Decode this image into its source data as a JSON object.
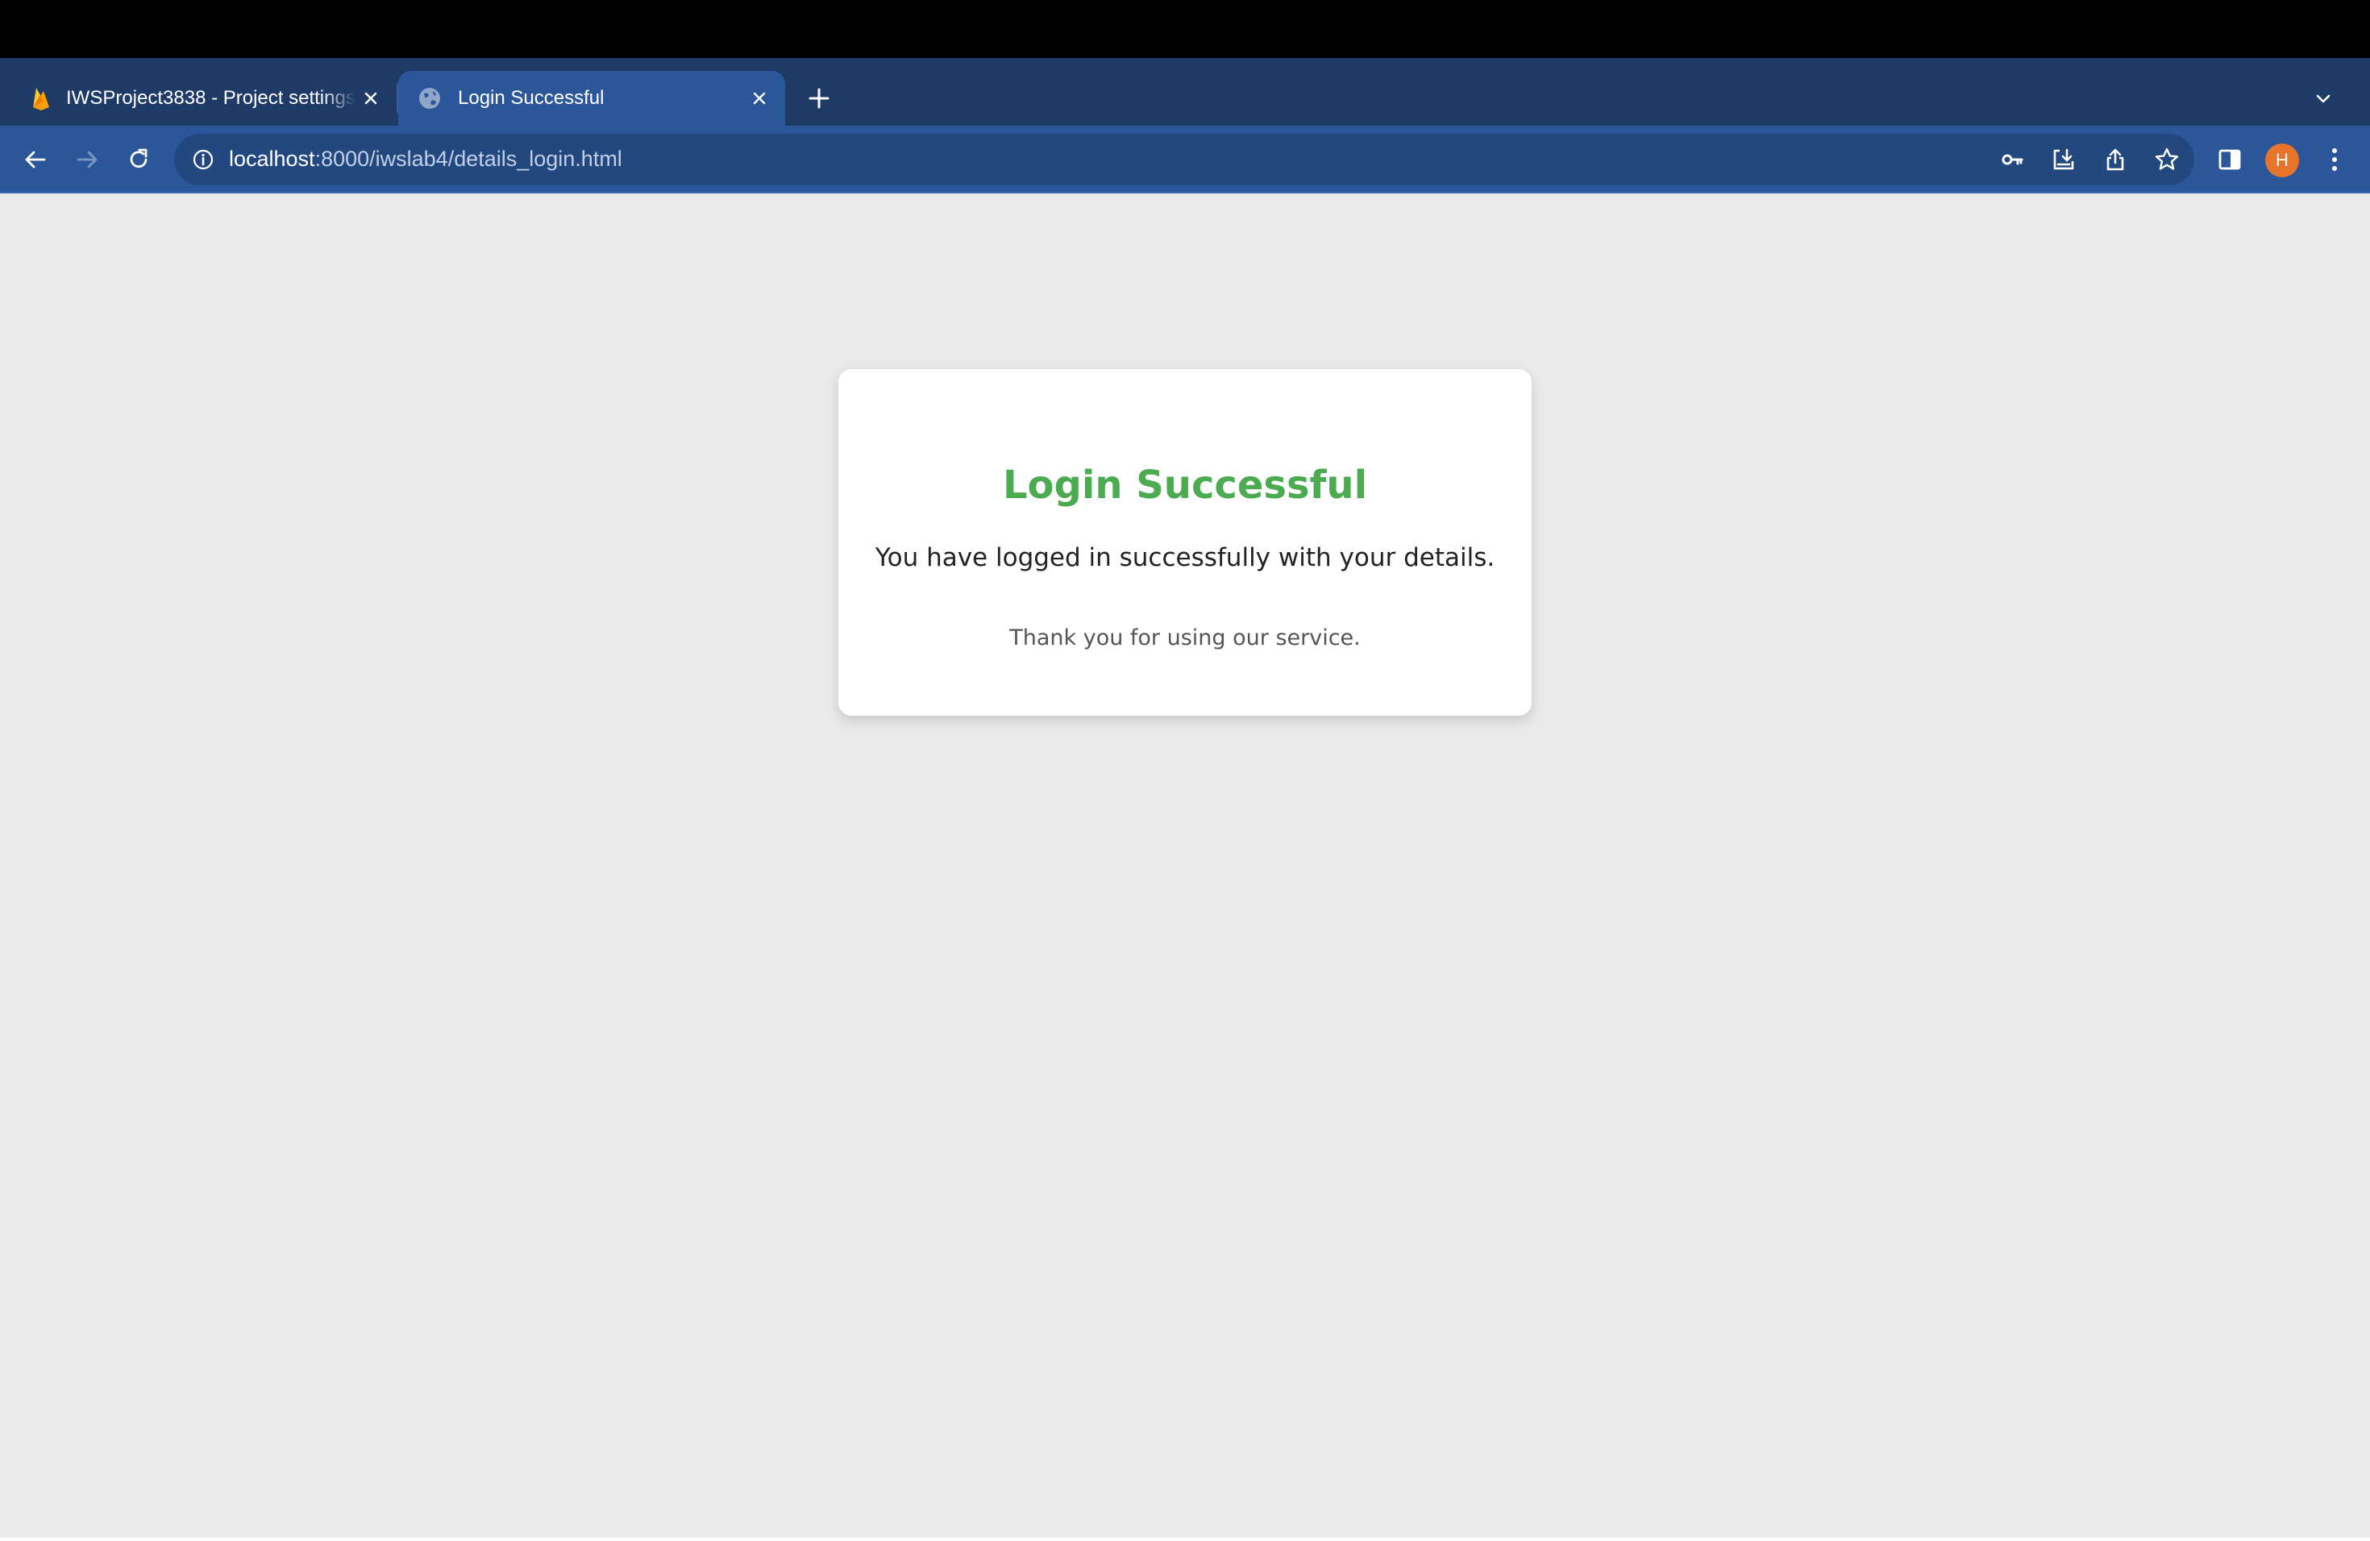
{
  "browser": {
    "tabs": [
      {
        "title": "IWSProject3838 - Project settings",
        "icon": "firebase-icon",
        "active": false
      },
      {
        "title": "Login Successful",
        "icon": "globe-icon",
        "active": true
      }
    ],
    "address_bar": {
      "host": "localhost",
      "path": ":8000/iwslab4/details_login.html"
    },
    "profile_initial": "H",
    "colors": {
      "tab_strip": "#1e3a66",
      "toolbar": "#2b579a",
      "avatar": "#e8742c"
    }
  },
  "page": {
    "title": "Login Successful",
    "message": "You have logged in successfully with your details.",
    "note": "Thank you for using our service.",
    "colors": {
      "background": "#eaeaea",
      "title": "#4caa50"
    }
  }
}
